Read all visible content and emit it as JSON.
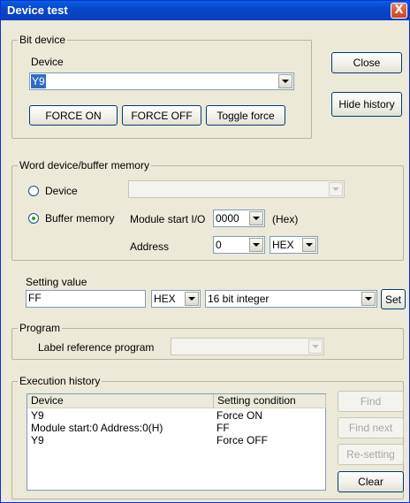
{
  "window": {
    "title": "Device test",
    "close_glyph": "X"
  },
  "bit_device": {
    "legend": "Bit device",
    "device_label": "Device",
    "device_value": "Y9",
    "force_on": "FORCE ON",
    "force_off": "FORCE OFF",
    "toggle_force": "Toggle force"
  },
  "side_buttons": {
    "close": "Close",
    "hide_history": "Hide history"
  },
  "word_device": {
    "legend": "Word device/buffer memory",
    "device_radio_label": "Device",
    "buffer_radio_label": "Buffer memory",
    "selected": "Buffer memory",
    "device_value": "",
    "module_start_label": "Module start I/O",
    "module_start_value": "0000",
    "hex_unit": "(Hex)",
    "address_label": "Address",
    "address_value": "0",
    "address_format": "HEX"
  },
  "setting_value": {
    "label": "Setting value",
    "value": "FF",
    "format": "HEX",
    "data_type": "16 bit integer",
    "set": "Set"
  },
  "program": {
    "legend": "Program",
    "label_reference": "Label reference program",
    "value": ""
  },
  "history": {
    "legend": "Execution history",
    "columns": [
      "Device",
      "Setting condition"
    ],
    "rows": [
      {
        "device": "Y9",
        "condition": "Force ON"
      },
      {
        "device": "Module start:0 Address:0(H)",
        "condition": "FF"
      },
      {
        "device": "Y9",
        "condition": "Force OFF"
      }
    ],
    "find": "Find",
    "find_next": "Find next",
    "resetting": "Re-setting",
    "clear": "Clear"
  }
}
